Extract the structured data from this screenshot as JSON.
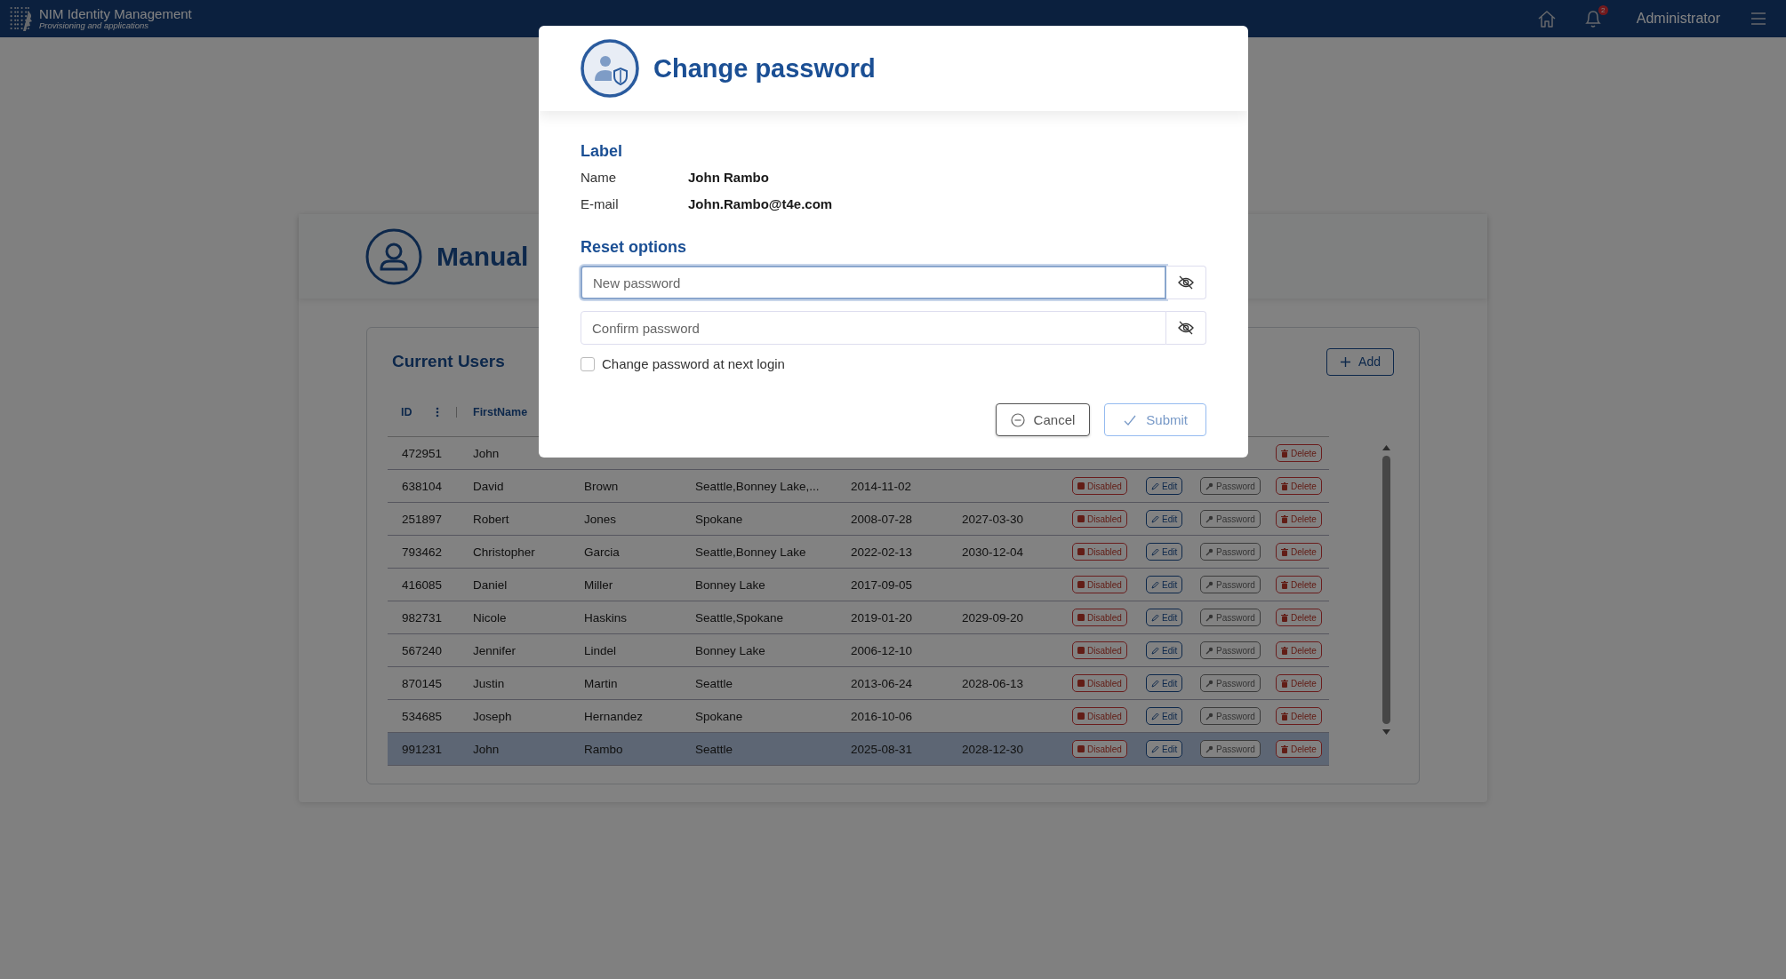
{
  "top_bar": {
    "app_title": "NIM Identity Management",
    "app_subtitle": "Provisioning and applications",
    "notification_count": "2",
    "user": "Administrator"
  },
  "page": {
    "title": "Manual"
  },
  "users_panel": {
    "title": "Current Users",
    "add_button": "Add",
    "columns": [
      "ID",
      "FirstName"
    ],
    "rows": [
      {
        "selected": false,
        "cells": [
          "472951",
          "John"
        ],
        "actions": [
          {
            "kind": "delete",
            "label": "Delete"
          }
        ]
      },
      {
        "selected": false,
        "cells": [
          "638104",
          "David",
          "Brown",
          "Seattle,Bonney Lake,...",
          "2014-11-02",
          ""
        ],
        "actions": [
          {
            "kind": "disable",
            "label": "Disabled"
          },
          {
            "kind": "edit",
            "label": "Edit"
          },
          {
            "kind": "password",
            "label": "Password"
          },
          {
            "kind": "delete",
            "label": "Delete"
          }
        ]
      },
      {
        "selected": false,
        "cells": [
          "251897",
          "Robert",
          "Jones",
          "Spokane",
          "2008-07-28",
          "2027-03-30"
        ],
        "actions": [
          {
            "kind": "disable",
            "label": "Disabled"
          },
          {
            "kind": "edit",
            "label": "Edit"
          },
          {
            "kind": "password",
            "label": "Password"
          },
          {
            "kind": "delete",
            "label": "Delete"
          }
        ]
      },
      {
        "selected": false,
        "cells": [
          "793462",
          "Christopher",
          "Garcia",
          "Seattle,Bonney Lake",
          "2022-02-13",
          "2030-12-04"
        ],
        "actions": [
          {
            "kind": "disable",
            "label": "Disabled"
          },
          {
            "kind": "edit",
            "label": "Edit"
          },
          {
            "kind": "password",
            "label": "Password"
          },
          {
            "kind": "delete",
            "label": "Delete"
          }
        ]
      },
      {
        "selected": false,
        "cells": [
          "416085",
          "Daniel",
          "Miller",
          "Bonney Lake",
          "2017-09-05",
          ""
        ],
        "actions": [
          {
            "kind": "disable",
            "label": "Disabled"
          },
          {
            "kind": "edit",
            "label": "Edit"
          },
          {
            "kind": "password",
            "label": "Password"
          },
          {
            "kind": "delete",
            "label": "Delete"
          }
        ]
      },
      {
        "selected": false,
        "cells": [
          "982731",
          "Nicole",
          "Haskins",
          "Seattle,Spokane",
          "2019-01-20",
          "2029-09-20"
        ],
        "actions": [
          {
            "kind": "disable",
            "label": "Disabled"
          },
          {
            "kind": "edit",
            "label": "Edit"
          },
          {
            "kind": "password",
            "label": "Password"
          },
          {
            "kind": "delete",
            "label": "Delete"
          }
        ]
      },
      {
        "selected": false,
        "cells": [
          "567240",
          "Jennifer",
          "Lindel",
          "Bonney Lake",
          "2006-12-10",
          ""
        ],
        "actions": [
          {
            "kind": "disable",
            "label": "Disabled"
          },
          {
            "kind": "edit",
            "label": "Edit"
          },
          {
            "kind": "password",
            "label": "Password"
          },
          {
            "kind": "delete",
            "label": "Delete"
          }
        ]
      },
      {
        "selected": false,
        "cells": [
          "870145",
          "Justin",
          "Martin",
          "Seattle",
          "2013-06-24",
          "2028-06-13"
        ],
        "actions": [
          {
            "kind": "disable",
            "label": "Disabled"
          },
          {
            "kind": "edit",
            "label": "Edit"
          },
          {
            "kind": "password",
            "label": "Password"
          },
          {
            "kind": "delete",
            "label": "Delete"
          }
        ]
      },
      {
        "selected": false,
        "cells": [
          "534685",
          "Joseph",
          "Hernandez",
          "Spokane",
          "2016-10-06",
          ""
        ],
        "actions": [
          {
            "kind": "disable",
            "label": "Disabled"
          },
          {
            "kind": "edit",
            "label": "Edit"
          },
          {
            "kind": "password",
            "label": "Password"
          },
          {
            "kind": "delete",
            "label": "Delete"
          }
        ]
      },
      {
        "selected": true,
        "cells": [
          "991231",
          "John",
          "Rambo",
          "Seattle",
          "2025-08-31",
          "2028-12-30"
        ],
        "actions": [
          {
            "kind": "disable",
            "label": "Disabled"
          },
          {
            "kind": "edit",
            "label": "Edit"
          },
          {
            "kind": "password",
            "label": "Password"
          },
          {
            "kind": "delete",
            "label": "Delete"
          }
        ]
      }
    ]
  },
  "dialog": {
    "title": "Change password",
    "info_heading": "Label",
    "info": [
      {
        "label": "Name",
        "value": "John Rambo"
      },
      {
        "label": "E-mail",
        "value": "John.Rambo@t4e.com"
      }
    ],
    "reset_heading": "Reset options",
    "fields": [
      {
        "placeholder": "New password",
        "focused": true
      },
      {
        "placeholder": "Confirm password",
        "focused": false
      }
    ],
    "checkbox": {
      "label": "Change password at next login",
      "checked": false
    },
    "buttons": [
      {
        "kind": "cancel",
        "label": "Cancel"
      },
      {
        "kind": "submit",
        "label": "Submit",
        "disabled": true
      }
    ]
  }
}
